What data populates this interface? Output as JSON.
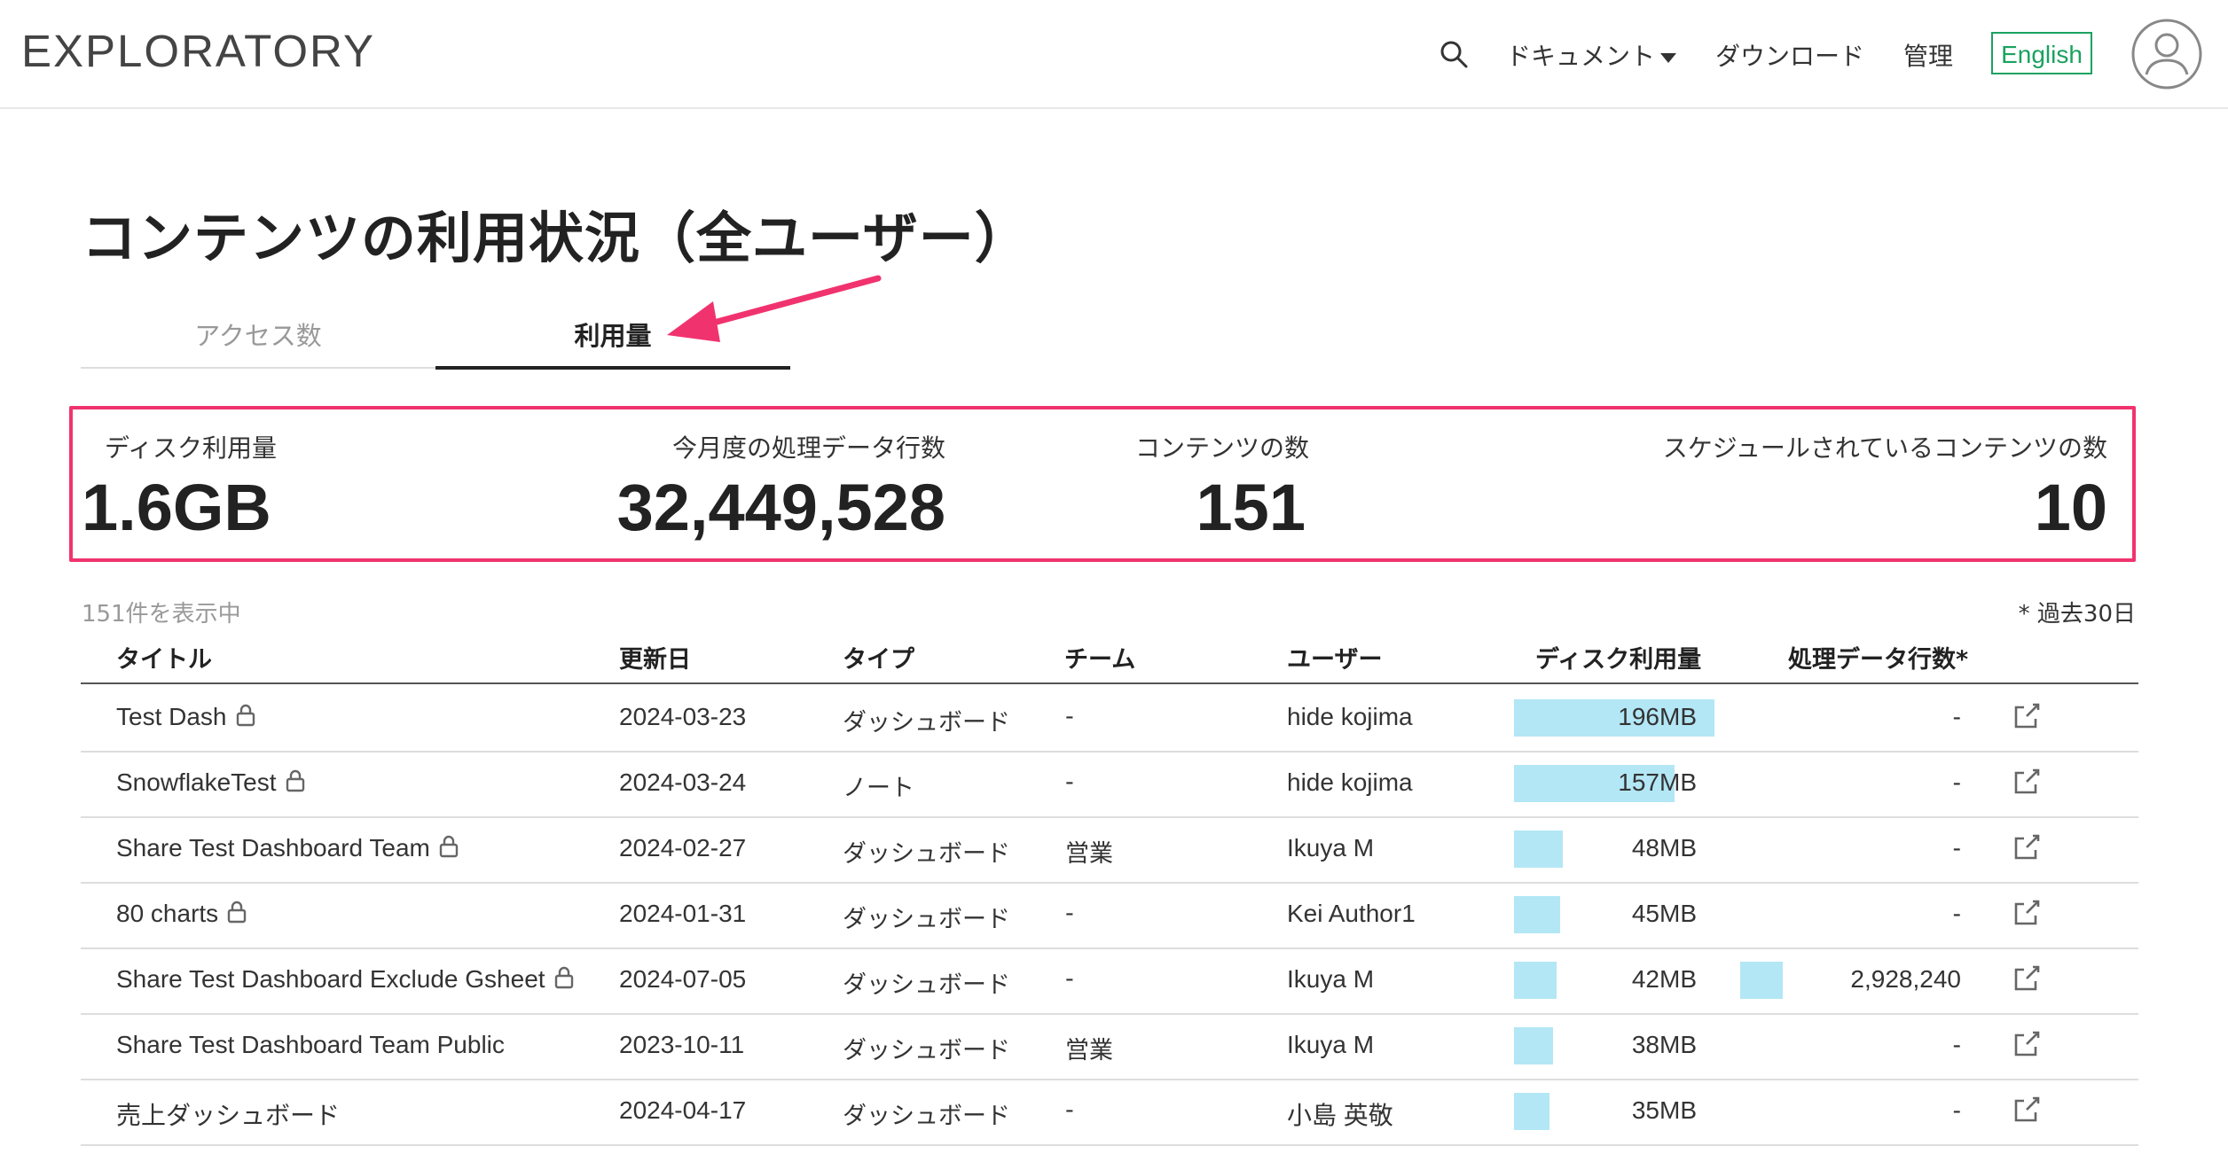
{
  "header": {
    "logo": "EXPLORATORY",
    "nav_documents": "ドキュメント",
    "nav_download": "ダウンロード",
    "nav_admin": "管理",
    "lang_button": "English"
  },
  "page_title": "コンテンツの利用状況（全ユーザー）",
  "tabs": [
    {
      "label": "アクセス数",
      "active": false
    },
    {
      "label": "利用量",
      "active": true
    }
  ],
  "stats": [
    {
      "label": "ディスク利用量",
      "value": "1.6GB"
    },
    {
      "label": "今月度の処理データ行数",
      "value": "32,449,528"
    },
    {
      "label": "コンテンツの数",
      "value": "151"
    },
    {
      "label": "スケジュールされているコンテンツの数",
      "value": "10"
    }
  ],
  "count_text": "151件を表示中",
  "note_text": "* 過去30日",
  "columns": [
    "タイトル",
    "更新日",
    "タイプ",
    "チーム",
    "ユーザー",
    "ディスク利用量",
    "処理データ行数*"
  ],
  "rows": [
    {
      "title": "Test Dash",
      "locked": true,
      "date": "2024-03-23",
      "type": "ダッシュボード",
      "team": "-",
      "user": "hide kojima",
      "disk": "196MB",
      "disk_fraction": 1.0,
      "rows": "-",
      "rows_fraction": 0
    },
    {
      "title": "SnowflakeTest",
      "locked": true,
      "date": "2024-03-24",
      "type": "ノート",
      "team": "-",
      "user": "hide kojima",
      "disk": "157MB",
      "disk_fraction": 0.8,
      "rows": "-",
      "rows_fraction": 0
    },
    {
      "title": "Share Test Dashboard Team",
      "locked": true,
      "date": "2024-02-27",
      "type": "ダッシュボード",
      "team": "営業",
      "user": "Ikuya M",
      "disk": "48MB",
      "disk_fraction": 0.245,
      "rows": "-",
      "rows_fraction": 0
    },
    {
      "title": "80 charts",
      "locked": true,
      "date": "2024-01-31",
      "type": "ダッシュボード",
      "team": "-",
      "user": "Kei Author1",
      "disk": "45MB",
      "disk_fraction": 0.23,
      "rows": "-",
      "rows_fraction": 0
    },
    {
      "title": "Share Test Dashboard Exclude Gsheet",
      "locked": true,
      "date": "2024-07-05",
      "type": "ダッシュボード",
      "team": "-",
      "user": "Ikuya M",
      "disk": "42MB",
      "disk_fraction": 0.214,
      "rows": "2,928,240",
      "rows_fraction": 0.2
    },
    {
      "title": "Share Test Dashboard Team Public",
      "locked": false,
      "date": "2023-10-11",
      "type": "ダッシュボード",
      "team": "営業",
      "user": "Ikuya M",
      "disk": "38MB",
      "disk_fraction": 0.194,
      "rows": "-",
      "rows_fraction": 0
    },
    {
      "title": "売上ダッシュボード",
      "locked": false,
      "date": "2024-04-17",
      "type": "ダッシュボード",
      "team": "-",
      "user": "小島 英敬",
      "disk": "35MB",
      "disk_fraction": 0.179,
      "rows": "-",
      "rows_fraction": 0
    }
  ],
  "colors": {
    "accent": "#1aa260",
    "highlight_box": "#f0336e",
    "bar": "#b3e7f5",
    "arrow": "#f0336e"
  }
}
